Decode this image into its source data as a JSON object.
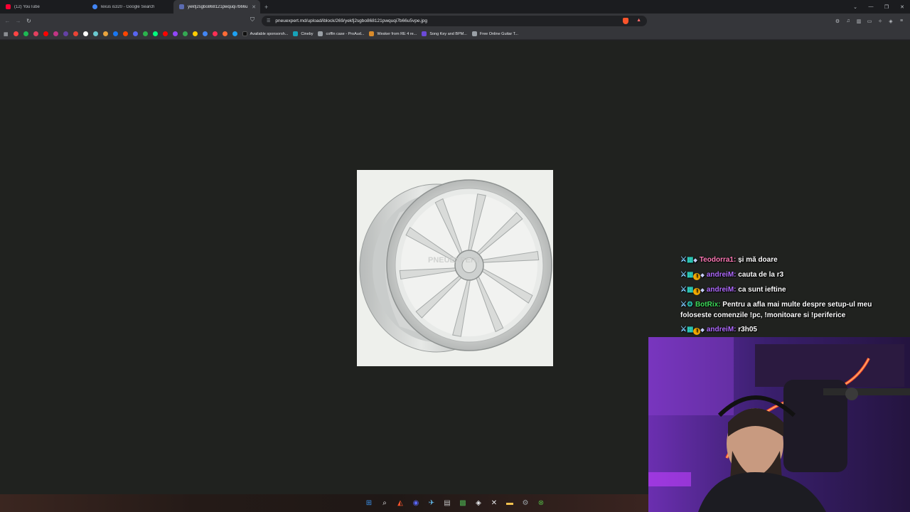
{
  "tabs": [
    {
      "title": "(12) YouTube",
      "color": "#ff0033",
      "active": false
    },
    {
      "title": "lexus is320 - Google Search",
      "color": "#4285f4",
      "active": false
    },
    {
      "title": "yekfj2sgbo868121pwquqi7b66u",
      "color": "#5b6bb0",
      "active": true
    }
  ],
  "address": {
    "url": "pneuexpert.md/upload/iblock/269/yekfj2sgbo868121pwquqi7b66u5vpe.jpg"
  },
  "bookmarks": [
    {
      "label": "Available sponsorsh...",
      "color": "#202124"
    },
    {
      "label": "Cineby",
      "color": "#17a2b8"
    },
    {
      "label": "coffin case - ProAud...",
      "color": "#9aa0a6"
    },
    {
      "label": "Wesker from RE 4 re...",
      "color": "#d98b2b"
    },
    {
      "label": "Song Key and BPM...",
      "color": "#6c4ad8"
    },
    {
      "label": "Free Online Guitar T...",
      "color": "#9aa0a6"
    }
  ],
  "bookmark_icon_colors": [
    "#ff4444",
    "#1db954",
    "#e4405f",
    "#ff0000",
    "#c13584",
    "#6441a5",
    "#ea4335",
    "#ffffff",
    "#69c9d0",
    "#e8a33d",
    "#1877f2",
    "#ff4500",
    "#5865f2",
    "#2bb24c",
    "#00ff7f",
    "#ff0000",
    "#9146ff",
    "#34a853",
    "#ffcc00",
    "#4285f4",
    "#ff2d55",
    "#ff6b35",
    "#1da1f2"
  ],
  "image": {
    "watermark": "PNEUEXPERT"
  },
  "chat": [
    {
      "user": "Teodorra1",
      "user_color": "#ff7ab6",
      "text": "și mă doare",
      "badges": [
        "sword",
        "sub",
        "gem"
      ]
    },
    {
      "user": "andreiM",
      "user_color": "#b06bff",
      "text": "cauta de la r3",
      "badges": [
        "sword",
        "sub",
        "coin",
        "gem"
      ]
    },
    {
      "user": "andreiM",
      "user_color": "#b06bff",
      "text": "ca sunt ieftine",
      "badges": [
        "sword",
        "sub",
        "coin",
        "gem"
      ]
    },
    {
      "user": "BotRix",
      "user_color": "#3ddc5a",
      "text": "Pentru a afla mai multe despre setup-ul meu foloseste comenzile !pc, !monitoare si !periferice",
      "badges": [
        "sword",
        "bot"
      ]
    },
    {
      "user": "andreiM",
      "user_color": "#b06bff",
      "text": "r3h05",
      "badges": [
        "sword",
        "sub",
        "coin",
        "gem"
      ]
    }
  ],
  "taskbar": [
    {
      "name": "start",
      "color": "#3a8ee6"
    },
    {
      "name": "search",
      "color": "#e8eaed"
    },
    {
      "name": "brave",
      "color": "#fb542b"
    },
    {
      "name": "discord",
      "color": "#5865f2"
    },
    {
      "name": "steam",
      "color": "#66c0f4"
    },
    {
      "name": "calculator",
      "color": "#c0c0c0"
    },
    {
      "name": "minecraft",
      "color": "#4caf50"
    },
    {
      "name": "epic",
      "color": "#e8eaed"
    },
    {
      "name": "capcut",
      "color": "#e8eaed"
    },
    {
      "name": "explorer",
      "color": "#f2c14e"
    },
    {
      "name": "settings",
      "color": "#9aa0a6"
    },
    {
      "name": "xbox",
      "color": "#52b043"
    }
  ]
}
